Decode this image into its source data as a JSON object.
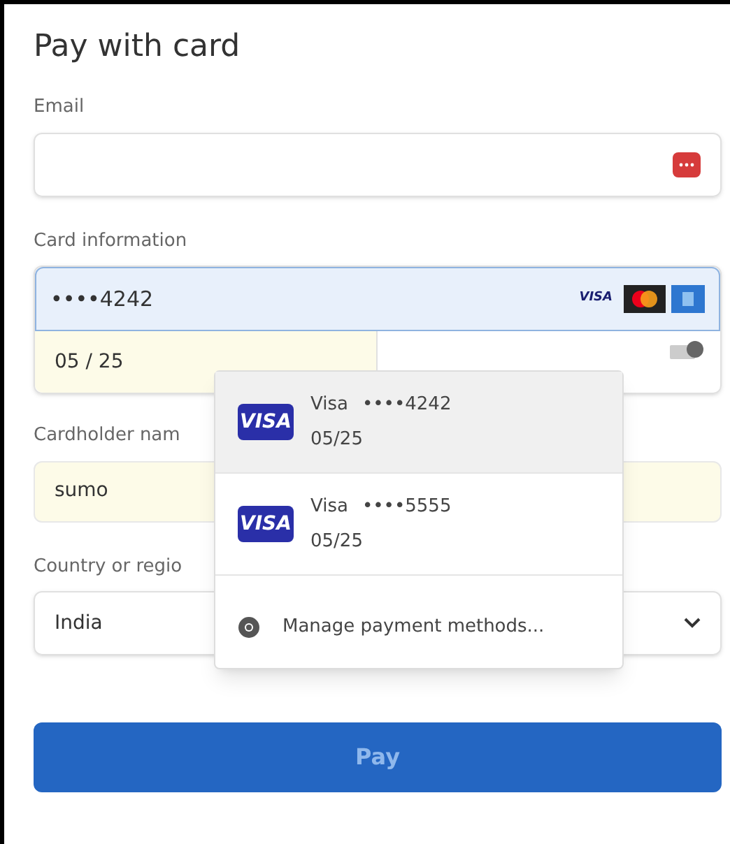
{
  "title": "Pay with card",
  "email": {
    "label": "Email"
  },
  "card": {
    "label": "Card information",
    "number": "••••4242",
    "focused": true,
    "brands": [
      "VISA"
    ],
    "expiry": "05 / 25",
    "expiry_autofilled": true
  },
  "cardholder": {
    "label": "Cardholder nam",
    "value": "sumo",
    "autofilled": true
  },
  "country": {
    "label": "Country or regio",
    "value": "India"
  },
  "autofill_menu": {
    "items": [
      {
        "brand": "VISA",
        "name": "Visa",
        "number": "••••4242",
        "expiry": "05/25",
        "selected": true
      },
      {
        "brand": "VISA",
        "name": "Visa",
        "number": "••••5555",
        "expiry": "05/25",
        "selected": false
      }
    ],
    "manage": "Manage payment methods..."
  },
  "pay_button": "Pay"
}
